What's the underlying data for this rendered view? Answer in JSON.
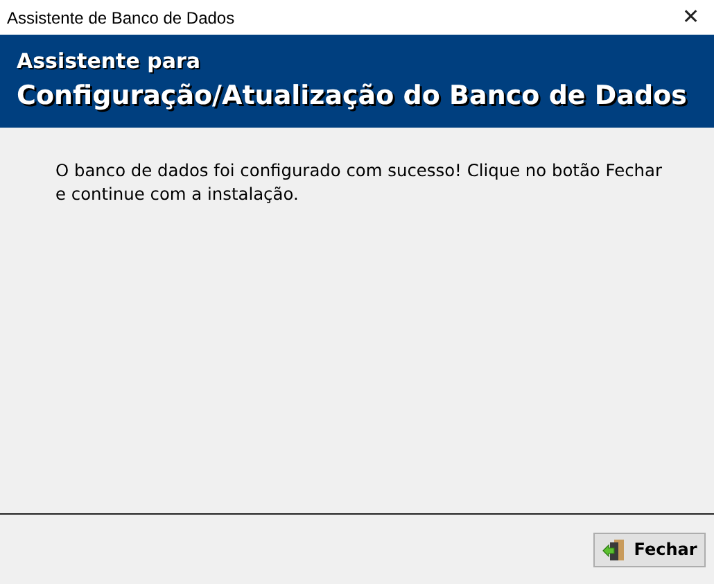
{
  "window": {
    "title": "Assistente de Banco de Dados",
    "close": "✕"
  },
  "header": {
    "subtitle": "Assistente para",
    "title": "Configuração/Atualização do Banco de Dados"
  },
  "message": "O banco de dados foi configurado com sucesso! Clique no botão Fechar e continue com a instalação.",
  "buttons": [
    {
      "kind": "exit",
      "label": "Fechar"
    }
  ]
}
